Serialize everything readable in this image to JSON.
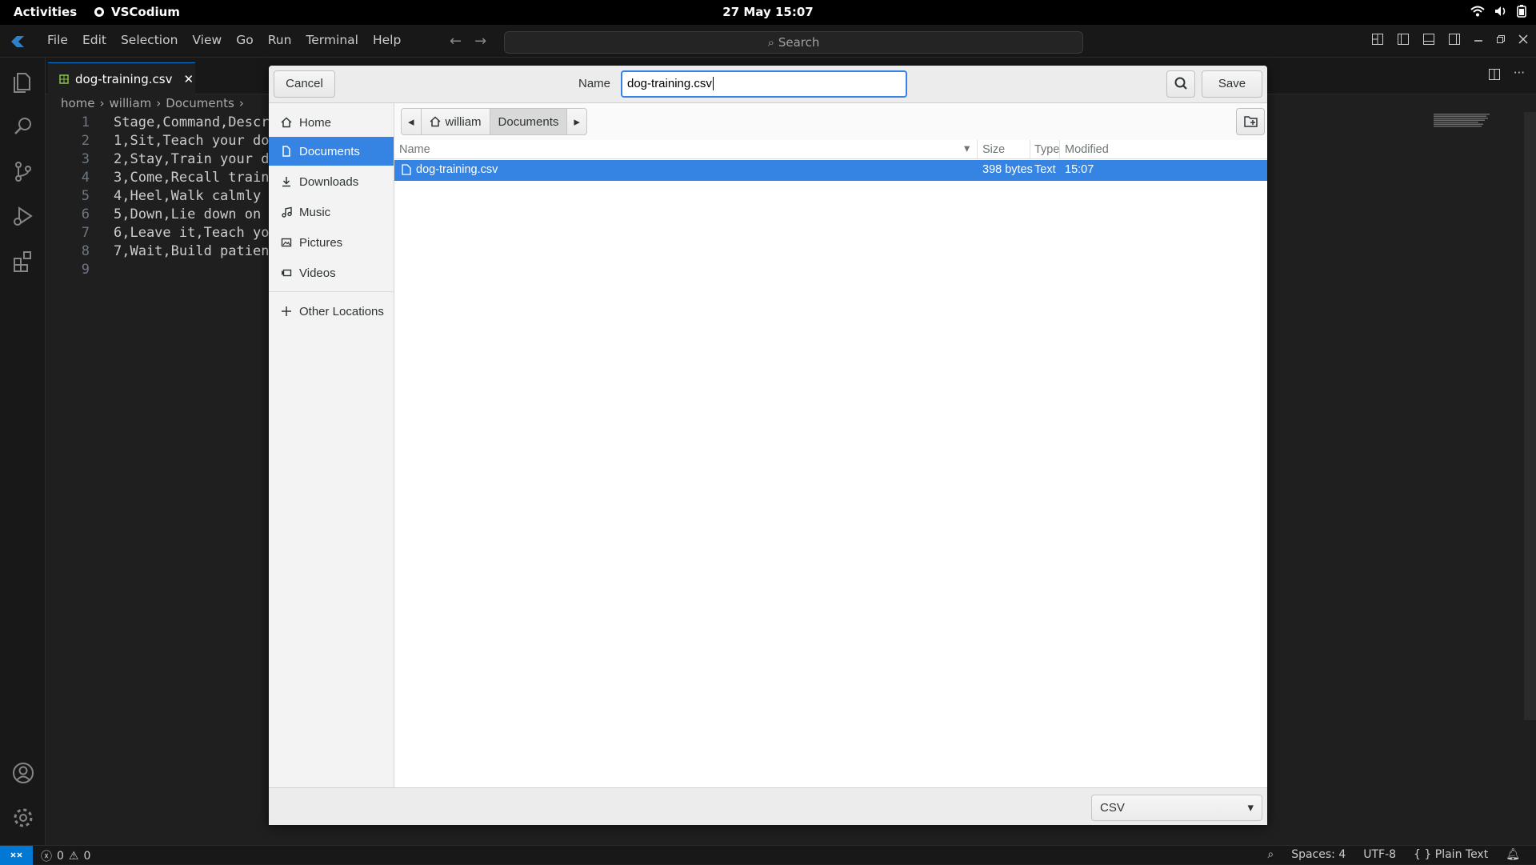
{
  "topbar": {
    "activities": "Activities",
    "app_name": "VSCodium",
    "clock": "27 May  15:07"
  },
  "titlebar": {
    "menu": [
      "File",
      "Edit",
      "Selection",
      "View",
      "Go",
      "Run",
      "Terminal",
      "Help"
    ],
    "search": "Search"
  },
  "editor": {
    "tab_label": "dog-training.csv",
    "breadcrumb": [
      "home",
      "william",
      "Documents"
    ],
    "lines": [
      {
        "n": "1",
        "text": "Stage,Command,Descr"
      },
      {
        "n": "2",
        "text": "1,Sit,Teach your do"
      },
      {
        "n": "3",
        "text": "2,Stay,Train your d"
      },
      {
        "n": "4",
        "text": "3,Come,Recall train"
      },
      {
        "n": "5",
        "text": "4,Heel,Walk calmly "
      },
      {
        "n": "6",
        "text": "5,Down,Lie down on "
      },
      {
        "n": "7",
        "text": "6,Leave it,Teach yo"
      },
      {
        "n": "8",
        "text": "7,Wait,Build patien"
      },
      {
        "n": "9",
        "text": ""
      }
    ]
  },
  "dialog": {
    "cancel": "Cancel",
    "name_label": "Name",
    "name_value": "dog-training.csv",
    "save": "Save",
    "sidebar": [
      "Home",
      "Documents",
      "Downloads",
      "Music",
      "Pictures",
      "Videos"
    ],
    "other_locations": "Other Locations",
    "path": [
      "william",
      "Documents"
    ],
    "columns": {
      "name": "Name",
      "size": "Size",
      "type": "Type",
      "modified": "Modified"
    },
    "files": [
      {
        "name": "dog-training.csv",
        "size": "398 bytes",
        "type": "Text",
        "modified": "15:07"
      }
    ],
    "filter": "CSV"
  },
  "statusbar": {
    "errors": "0",
    "warnings": "0",
    "spaces": "Spaces: 4",
    "encoding": "UTF-8",
    "language": "Plain Text"
  },
  "colors": {
    "accent": "#3584e4",
    "vscode_blue": "#0078d4"
  }
}
